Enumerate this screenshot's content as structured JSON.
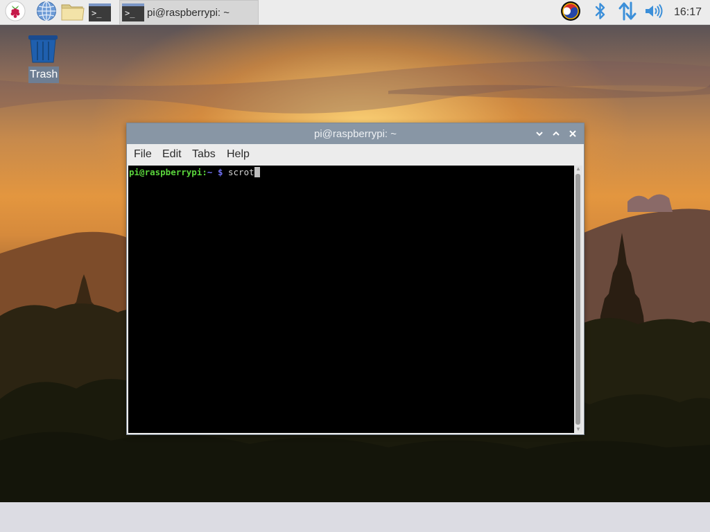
{
  "panel": {
    "launchers": [
      {
        "icon": "raspberry-menu-icon"
      },
      {
        "icon": "web-browser-globe-icon"
      },
      {
        "icon": "file-manager-folder-icon"
      },
      {
        "icon": "terminal-icon",
        "glyph": ">_"
      }
    ],
    "taskbar": {
      "active_window_label": "pi@raspberrypi: ~",
      "glyph": ">_"
    },
    "tray": [
      {
        "icon": "input-method-taeguk-icon"
      },
      {
        "icon": "bluetooth-icon"
      },
      {
        "icon": "network-updown-arrows-icon"
      },
      {
        "icon": "volume-icon"
      }
    ],
    "clock": "16:17"
  },
  "desktop": {
    "icons": [
      {
        "label": "Trash",
        "icon": "trash-icon"
      }
    ],
    "wallpaper": "sunset over temples"
  },
  "terminal_window": {
    "title": "pi@raspberrypi: ~",
    "controls": [
      "minimize",
      "maximize",
      "close"
    ],
    "menu": [
      "File",
      "Edit",
      "Tabs",
      "Help"
    ],
    "prompt_user": "pi@raspberrypi",
    "prompt_sep": ":",
    "prompt_path": "~ $",
    "command": " scrot"
  },
  "colors": {
    "titlebar": "#8896a5",
    "prompt_user": "#5ad53c",
    "prompt_path": "#6f6ff0",
    "panel_bg": "#ececec",
    "taskbar_bottom": "#dcdce3"
  }
}
